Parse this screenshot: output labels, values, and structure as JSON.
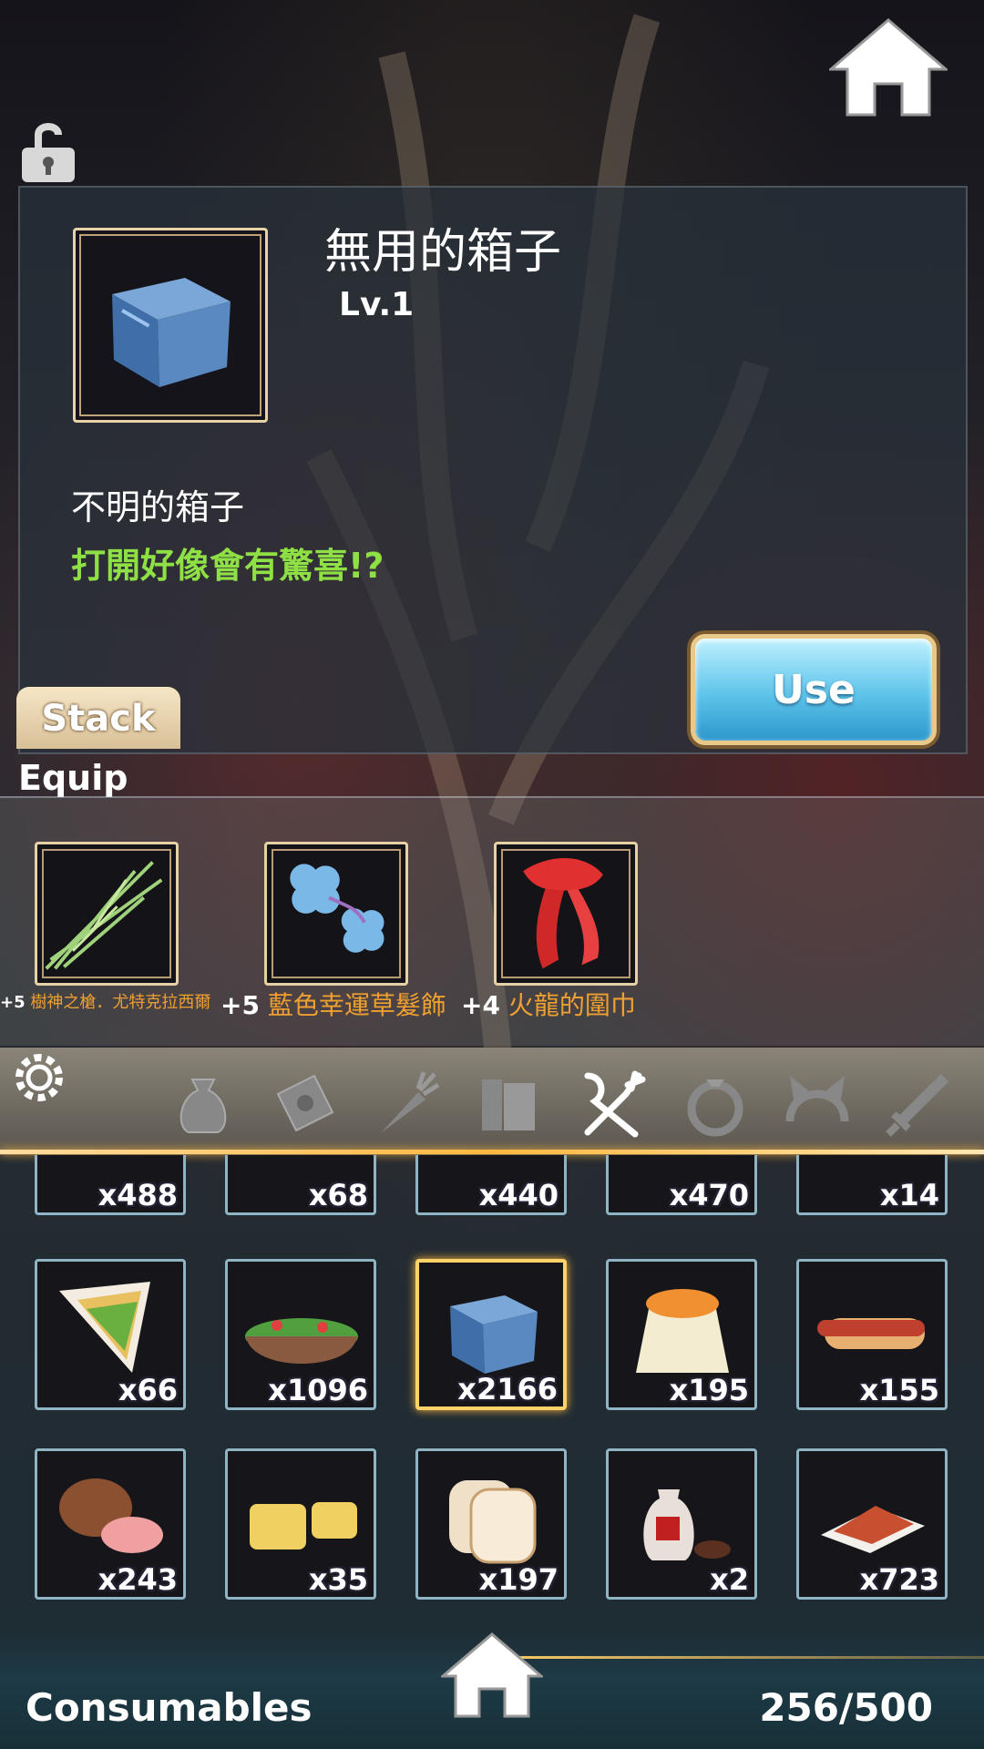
{
  "item": {
    "name": "無用的箱子",
    "level": "Lv.1",
    "description": "不明的箱子",
    "hint": "打開好像會有驚喜!?",
    "use_label": "Use",
    "stack_label": "Stack"
  },
  "equip": {
    "label": "Equip",
    "items": [
      {
        "plus": "+5",
        "name": "樹神之槍．尤特克拉西爾",
        "icon": "spear-icon"
      },
      {
        "plus": "+5",
        "name": "藍色幸運草髮飾",
        "icon": "clover-hairpin-icon"
      },
      {
        "plus": "+4",
        "name": "火龍的圍巾",
        "icon": "red-scarf-icon"
      }
    ]
  },
  "tabs": [
    "bag-icon",
    "scroll-icon",
    "carrot-icon",
    "books-icon",
    "utensils-icon",
    "ring-icon",
    "headband-icon",
    "sword-icon"
  ],
  "inventory": {
    "partial_row": [
      "x488",
      "x68",
      "x440",
      "x470",
      "x14"
    ],
    "row1": [
      {
        "qty": "x66",
        "icon": "sandwich-icon"
      },
      {
        "qty": "x1096",
        "icon": "salad-icon"
      },
      {
        "qty": "x2166",
        "icon": "box-icon",
        "selected": true
      },
      {
        "qty": "x195",
        "icon": "pudding-icon"
      },
      {
        "qty": "x155",
        "icon": "hotdog-icon"
      }
    ],
    "row2": [
      {
        "qty": "x243",
        "icon": "ham-icon"
      },
      {
        "qty": "x35",
        "icon": "cheese-icon"
      },
      {
        "qty": "x197",
        "icon": "bread-icon"
      },
      {
        "qty": "x2",
        "icon": "wine-jar-icon"
      },
      {
        "qty": "x723",
        "icon": "spice-icon"
      }
    ]
  },
  "footer": {
    "category": "Consumables",
    "count": "256/500"
  },
  "colors": {
    "hint_green": "#8fe045",
    "gold": "#ffb940",
    "equip_name": "#f0a030"
  }
}
